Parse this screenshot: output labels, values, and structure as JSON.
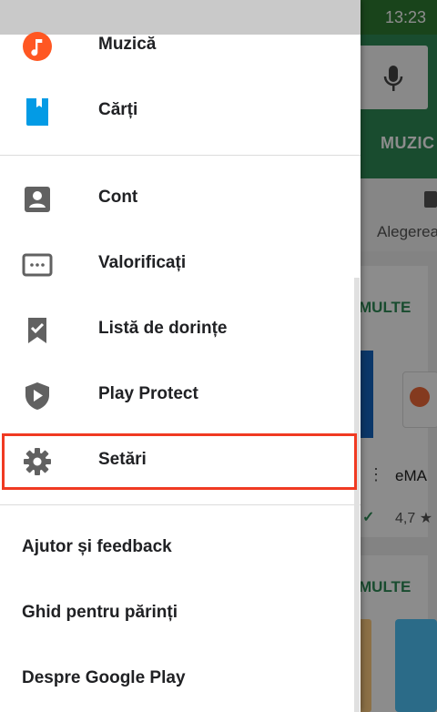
{
  "background": {
    "clock": "13:23",
    "tab_label": "MUZIC",
    "choice_label": "Alegerea",
    "more_label_1": "MULTE",
    "more_label_2": "MULTE",
    "app_name": "eMA",
    "app_rating": "4,7 ★",
    "icons": [
      "mic-icon",
      "check-icon",
      "more-vert-icon"
    ],
    "colors": {
      "header": "#2e8b57"
    }
  },
  "drawer": {
    "items": [
      {
        "id": "muzica",
        "label": "Muzică",
        "icon": "music-icon",
        "color": "#ff5722"
      },
      {
        "id": "carti",
        "label": "Cărți",
        "icon": "book-icon",
        "color": "#039be5"
      },
      {
        "id": "cont",
        "label": "Cont",
        "icon": "account-icon",
        "color": "#616161"
      },
      {
        "id": "valorificati",
        "label": "Valorificați",
        "icon": "redeem-icon",
        "color": "#616161"
      },
      {
        "id": "lista",
        "label": "Listă de dorințe",
        "icon": "wishlist-bookmark-icon",
        "color": "#616161"
      },
      {
        "id": "play-protect",
        "label": "Play Protect",
        "icon": "shield-play-icon",
        "color": "#616161"
      },
      {
        "id": "setari",
        "label": "Setări",
        "icon": "gear-icon",
        "color": "#616161"
      }
    ],
    "footer_items": [
      {
        "id": "ajutor",
        "label": "Ajutor și feedback"
      },
      {
        "id": "ghid",
        "label": "Ghid pentru părinți"
      },
      {
        "id": "despre",
        "label": "Despre Google Play"
      }
    ],
    "highlighted_item": "setari",
    "highlight_color": "#f03a22"
  }
}
